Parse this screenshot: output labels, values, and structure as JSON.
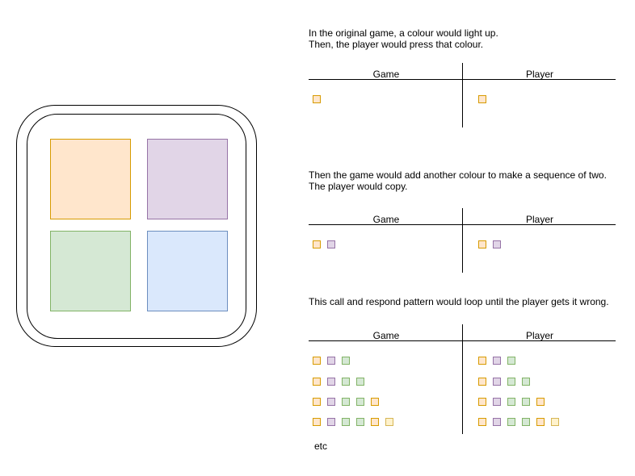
{
  "colors": {
    "orange": {
      "fill": "#ffe6cc",
      "stroke": "#d79b00"
    },
    "purple": {
      "fill": "#e1d5e7",
      "stroke": "#9673a6"
    },
    "green": {
      "fill": "#d5e8d4",
      "stroke": "#82b366"
    },
    "blue": {
      "fill": "#dae8fc",
      "stroke": "#6c8ebf"
    },
    "yellow": {
      "fill": "#fff2cc",
      "stroke": "#d6b656"
    }
  },
  "device": {
    "pads": [
      "orange",
      "purple",
      "green",
      "blue"
    ]
  },
  "sections": [
    {
      "caption": "In the original game, a colour would light up.\nThen, the player would press that colour.",
      "game_label": "Game",
      "player_label": "Player",
      "rows": [
        [
          "orange"
        ]
      ]
    },
    {
      "caption": "Then the game would add another colour to make a sequence of two.\nThe player would copy.",
      "game_label": "Game",
      "player_label": "Player",
      "rows": [
        [
          "orange",
          "purple"
        ]
      ]
    },
    {
      "caption": "This call and respond pattern would loop until the player gets it wrong.",
      "game_label": "Game",
      "player_label": "Player",
      "rows": [
        [
          "orange",
          "purple",
          "green"
        ],
        [
          "orange",
          "purple",
          "green",
          "green"
        ],
        [
          "orange",
          "purple",
          "green",
          "green",
          "orange"
        ],
        [
          "orange",
          "purple",
          "green",
          "green",
          "orange",
          "yellow"
        ]
      ]
    }
  ],
  "footer": "etc"
}
